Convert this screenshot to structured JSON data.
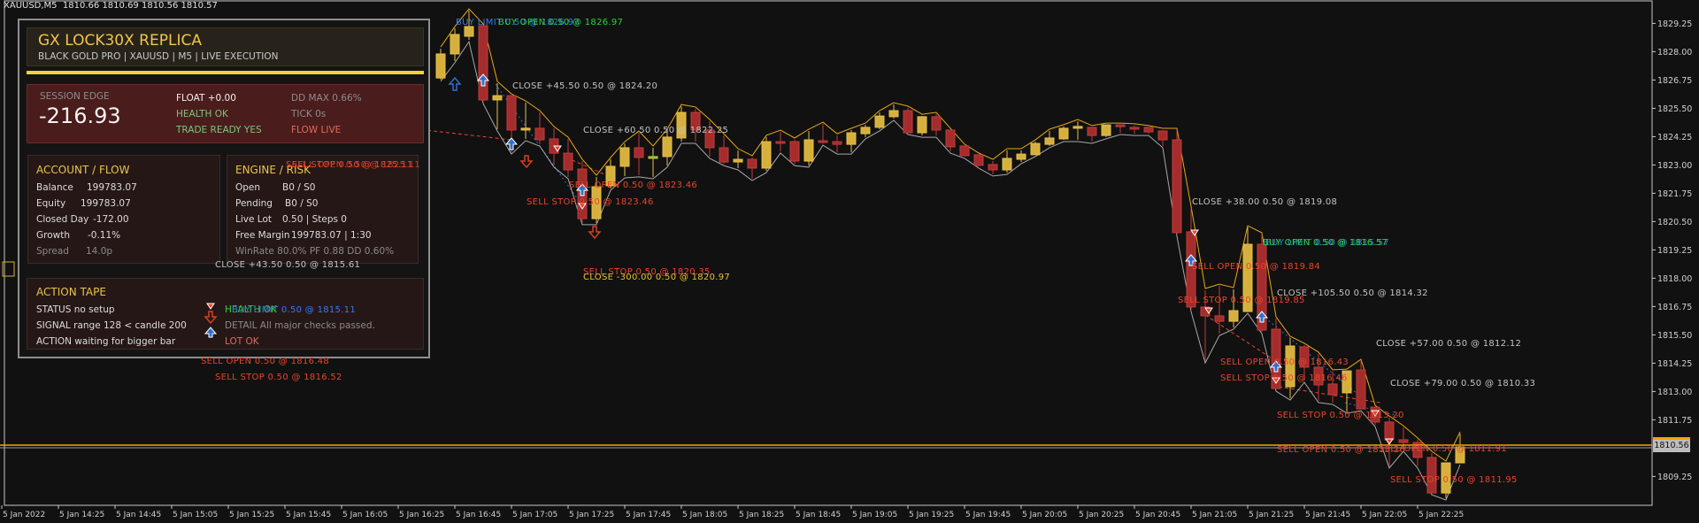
{
  "window": {
    "symbol": "XAUUSD,M5",
    "ohlc": "1810.66 1810.69 1810.56 1810.57"
  },
  "panel": {
    "title": "GX LOCK30X REPLICA",
    "subtitle": "BLACK GOLD PRO  |  XAUUSD  |  M5  |  LIVE EXECUTION",
    "session": {
      "label": "SESSION EDGE",
      "value": "-216.93",
      "float": "FLOAT +0.00",
      "health": "HEALTH OK",
      "trade_ready": "TRADE READY YES",
      "dd_max": "DD MAX 0.66%",
      "tick": "TICK 0s",
      "flow": "FLOW LIVE"
    },
    "account": {
      "title": "ACCOUNT / FLOW",
      "rows": [
        {
          "label": "Balance",
          "value": "199783.07"
        },
        {
          "label": "Equity",
          "value": "199783.07"
        },
        {
          "label": "Closed Day",
          "value": "-172.00"
        },
        {
          "label": "Growth",
          "value": "-0.11%"
        },
        {
          "label": "Spread",
          "value": "14.0p"
        }
      ]
    },
    "engine": {
      "title": "ENGINE / RISK",
      "rows": [
        {
          "label": "Open",
          "value": "B0 / S0"
        },
        {
          "label": "Pending",
          "value": "B0 / S0"
        },
        {
          "label": "Live Lot",
          "value": "0.50  |  Steps 0"
        },
        {
          "label": "Free Margin",
          "value": "199783.07  |  1:30"
        }
      ],
      "stats": "WinRate 80.0%  PF 0.88  DD 0.60%"
    },
    "tape": {
      "title": "ACTION TAPE",
      "status": "STATUS  no setup",
      "signal": "SIGNAL  range 128 < candle 200",
      "action": "ACTION  waiting for bigger bar",
      "health": "HEALTH OK",
      "detail": "DETAIL  All major checks passed.",
      "lot": "LOT     OK"
    }
  },
  "annotations": [
    {
      "text": "BUY LIMIT 0.50 @ 1826.97",
      "kind": "blue"
    },
    {
      "text": "BUY OPEN 0.50 @ 1826.97",
      "kind": "green"
    },
    {
      "text": "CLOSE +45.50 0.50 @ 1824.20",
      "kind": "gray"
    },
    {
      "text": "CLOSE +60.50 0.50 @ 1822.25",
      "kind": "gray"
    },
    {
      "text": "SELL OPEN 0.50 @ 1823.46",
      "kind": "red"
    },
    {
      "text": "SELL STOP 0.50 @ 1823.46",
      "kind": "red"
    },
    {
      "text": "SELL STOP 0.50 @ 1820.35",
      "kind": "red"
    },
    {
      "text": "CLOSE -300.00 0.50 @ 1820.97",
      "kind": "gold"
    },
    {
      "text": "SELL STOP 0.50 @ 1825.11",
      "kind": "red"
    },
    {
      "text": "SELL OPEN 0.50 @ 1825.11",
      "kind": "red"
    },
    {
      "text": "CLOSE +43.50 0.50 @ 1815.61",
      "kind": "gray"
    },
    {
      "text": "BUY LIMIT 0.50 @ 1815.11",
      "kind": "blue"
    },
    {
      "text": "SELL OPEN 0.50 @ 1816.48",
      "kind": "red"
    },
    {
      "text": "SELL STOP 0.50 @ 1816.52",
      "kind": "red"
    },
    {
      "text": "CLOSE +38.00 0.50 @ 1819.08",
      "kind": "gray"
    },
    {
      "text": "BUY OPEN 0.50 @ 1816.57",
      "kind": "green"
    },
    {
      "text": "BUY LIMIT 0.50 @ 1815.57",
      "kind": "blue"
    },
    {
      "text": "SELL OPEN 0.50 @ 1819.84",
      "kind": "red"
    },
    {
      "text": "CLOSE +105.50 0.50 @ 1814.32",
      "kind": "gray"
    },
    {
      "text": "SELL STOP 0.50 @ 1819.85",
      "kind": "red"
    },
    {
      "text": "CLOSE +57.00 0.50 @ 1812.12",
      "kind": "gray"
    },
    {
      "text": "SELL OPEN 0.50 @ 1816.43",
      "kind": "red"
    },
    {
      "text": "SELL STOP 0.50 @ 1816.46",
      "kind": "red"
    },
    {
      "text": "CLOSE +79.00 0.50 @ 1810.33",
      "kind": "gray"
    },
    {
      "text": "SELL STOP 0.50 @ 1813.20",
      "kind": "red"
    },
    {
      "text": "SELL OPEN 0.50 @ 1813.26",
      "kind": "red"
    },
    {
      "text": "SELL OPEN 0.50 @ 1811.91",
      "kind": "red"
    },
    {
      "text": "SELL STOP 0.50 @ 1811.95",
      "kind": "red"
    }
  ],
  "colors": {
    "background": "#111111",
    "bull": "#d6b03c",
    "bear": "#a52c2c",
    "upper_band": "#e8a817",
    "lower_band": "#a8a8a8",
    "bid_line": "#f0a800",
    "accent": "#efc64c"
  },
  "chart_data": {
    "type": "candlestick",
    "symbol": "XAUUSD",
    "timeframe": "M5",
    "current_price": "1810.56",
    "ylim": [
      1808.2,
      1830.3
    ],
    "y_ticks": [
      "1829.25",
      "1828.00",
      "1826.75",
      "1825.50",
      "1824.25",
      "1823.00",
      "1821.75",
      "1820.50",
      "1819.25",
      "1818.00",
      "1816.75",
      "1815.50",
      "1814.25",
      "1813.00",
      "1811.75",
      "1809.25"
    ],
    "x_ticks": [
      "5 Jan 2022",
      "5 Jan 14:25",
      "5 Jan 14:45",
      "5 Jan 15:05",
      "5 Jan 15:25",
      "5 Jan 15:45",
      "5 Jan 16:05",
      "5 Jan 16:25",
      "5 Jan 16:45",
      "5 Jan 17:05",
      "5 Jan 17:25",
      "5 Jan 17:45",
      "5 Jan 18:05",
      "5 Jan 18:25",
      "5 Jan 18:45",
      "5 Jan 19:05",
      "5 Jan 19:25",
      "5 Jan 19:45",
      "5 Jan 20:05",
      "5 Jan 20:25",
      "5 Jan 20:45",
      "5 Jan 21:05",
      "5 Jan 21:25",
      "5 Jan 21:45",
      "5 Jan 22:05",
      "5 Jan 22:25"
    ],
    "grid": false,
    "ohlc": [
      [
        1826.84,
        1828.13,
        1826.77,
        1827.9
      ],
      [
        1827.9,
        1829.03,
        1827.59,
        1828.76
      ],
      [
        1828.68,
        1829.81,
        1828.52,
        1829.11
      ],
      [
        1829.15,
        1829.15,
        1825.79,
        1825.87
      ],
      [
        1825.87,
        1826.61,
        1824.58,
        1826.06
      ],
      [
        1826.06,
        1826.06,
        1823.56,
        1824.54
      ],
      [
        1824.58,
        1825.75,
        1824.15,
        1824.62
      ],
      [
        1824.62,
        1825.32,
        1823.91,
        1824.11
      ],
      [
        1824.15,
        1824.62,
        1822.98,
        1823.52
      ],
      [
        1823.52,
        1824.15,
        1822.47,
        1822.78
      ],
      [
        1822.82,
        1823.17,
        1820.44,
        1820.63
      ],
      [
        1820.63,
        1822.47,
        1820.44,
        1822.04
      ],
      [
        1822.08,
        1823.25,
        1821.96,
        1822.94
      ],
      [
        1822.94,
        1823.95,
        1822.51,
        1823.76
      ],
      [
        1823.76,
        1824.42,
        1822.55,
        1823.33
      ],
      [
        1823.37,
        1823.76,
        1822.47,
        1823.37
      ],
      [
        1823.37,
        1824.5,
        1822.98,
        1824.23
      ],
      [
        1824.19,
        1825.59,
        1824.03,
        1825.32
      ],
      [
        1825.32,
        1825.48,
        1824.03,
        1824.54
      ],
      [
        1824.54,
        1824.93,
        1823.37,
        1823.76
      ],
      [
        1823.76,
        1824.3,
        1823.05,
        1823.13
      ],
      [
        1823.13,
        1823.64,
        1822.86,
        1823.25
      ],
      [
        1823.25,
        1823.33,
        1822.39,
        1822.86
      ],
      [
        1822.86,
        1824.23,
        1822.74,
        1824.03
      ],
      [
        1824.03,
        1824.46,
        1823.6,
        1823.99
      ],
      [
        1824.03,
        1824.11,
        1823.05,
        1823.17
      ],
      [
        1823.17,
        1824.5,
        1822.98,
        1824.11
      ],
      [
        1824.07,
        1824.81,
        1823.95,
        1824.03
      ],
      [
        1824.03,
        1824.3,
        1823.56,
        1823.91
      ],
      [
        1823.91,
        1824.54,
        1823.56,
        1824.42
      ],
      [
        1824.38,
        1824.77,
        1824.23,
        1824.66
      ],
      [
        1824.66,
        1825.32,
        1824.58,
        1825.16
      ],
      [
        1825.13,
        1825.67,
        1825.05,
        1825.4
      ],
      [
        1825.4,
        1825.52,
        1824.42,
        1824.42
      ],
      [
        1824.42,
        1825.16,
        1824.3,
        1825.13
      ],
      [
        1825.13,
        1825.24,
        1824.3,
        1824.54
      ],
      [
        1824.54,
        1824.54,
        1823.6,
        1823.8
      ],
      [
        1823.84,
        1823.84,
        1823.37,
        1823.41
      ],
      [
        1823.45,
        1823.45,
        1822.94,
        1822.98
      ],
      [
        1823.02,
        1823.17,
        1822.59,
        1822.78
      ],
      [
        1822.78,
        1823.64,
        1822.66,
        1823.29
      ],
      [
        1823.25,
        1823.64,
        1823.13,
        1823.48
      ],
      [
        1823.45,
        1824.03,
        1823.45,
        1823.95
      ],
      [
        1823.91,
        1824.5,
        1823.84,
        1824.19
      ],
      [
        1824.15,
        1824.7,
        1824.11,
        1824.62
      ],
      [
        1824.62,
        1824.93,
        1824.11,
        1824.7
      ],
      [
        1824.66,
        1824.66,
        1824.03,
        1824.3
      ],
      [
        1824.3,
        1824.77,
        1824.23,
        1824.77
      ],
      [
        1824.77,
        1824.77,
        1824.42,
        1824.7
      ],
      [
        1824.66,
        1824.74,
        1824.38,
        1824.62
      ],
      [
        1824.66,
        1824.66,
        1824.38,
        1824.46
      ],
      [
        1824.5,
        1824.54,
        1823.84,
        1824.11
      ],
      [
        1824.11,
        1824.54,
        1819.93,
        1820.01
      ],
      [
        1820.05,
        1821.1,
        1816.61,
        1816.73
      ],
      [
        1816.73,
        1817.47,
        1814.34,
        1816.34
      ],
      [
        1816.34,
        1817.66,
        1815.55,
        1816.1
      ],
      [
        1816.1,
        1817.51,
        1815.83,
        1816.57
      ],
      [
        1816.53,
        1820.24,
        1816.53,
        1819.5
      ],
      [
        1819.5,
        1819.93,
        1815.63,
        1815.71
      ],
      [
        1815.75,
        1816.22,
        1813.09,
        1813.13
      ],
      [
        1813.21,
        1815.36,
        1812.7,
        1815.01
      ],
      [
        1814.97,
        1815.05,
        1813.48,
        1814.07
      ],
      [
        1814.07,
        1814.66,
        1812.59,
        1813.29
      ],
      [
        1813.33,
        1813.88,
        1812.51,
        1812.86
      ],
      [
        1812.94,
        1813.91,
        1812.12,
        1813.91
      ],
      [
        1813.95,
        1814.34,
        1812.23,
        1812.23
      ],
      [
        1812.31,
        1812.31,
        1811.53,
        1811.65
      ],
      [
        1811.65,
        1811.84,
        1809.7,
        1810.87
      ],
      [
        1810.87,
        1811.41,
        1810.44,
        1810.75
      ],
      [
        1810.75,
        1810.87,
        1809.7,
        1810.09
      ],
      [
        1810.09,
        1810.28,
        1808.52,
        1808.52
      ],
      [
        1808.52,
        1809.85,
        1808.29,
        1809.85
      ],
      [
        1809.85,
        1811.14,
        1809.85,
        1810.55
      ]
    ]
  }
}
